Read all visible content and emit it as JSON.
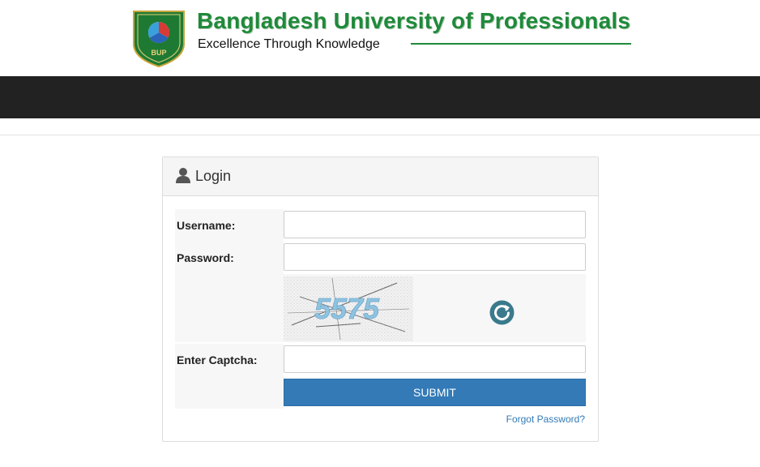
{
  "header": {
    "title": "Bangladesh University of Professionals",
    "tagline": "Excellence Through Knowledge",
    "logo_letters": "BUP"
  },
  "login": {
    "title": "Login",
    "username_label": "Username:",
    "username_value": "",
    "password_label": "Password:",
    "password_value": "",
    "captcha_text": "5575",
    "captcha_label": "Enter Captcha:",
    "captcha_value": "",
    "submit_label": "SUBMIT",
    "forgot_label": "Forgot Password?"
  },
  "colors": {
    "brand_green": "#1f8a3a",
    "navbar": "#222222",
    "primary_button": "#337ab7",
    "refresh_icon": "#3a7a8c"
  },
  "icons": {
    "panel_icon": "user-icon",
    "captcha_refresh": "refresh-icon"
  }
}
